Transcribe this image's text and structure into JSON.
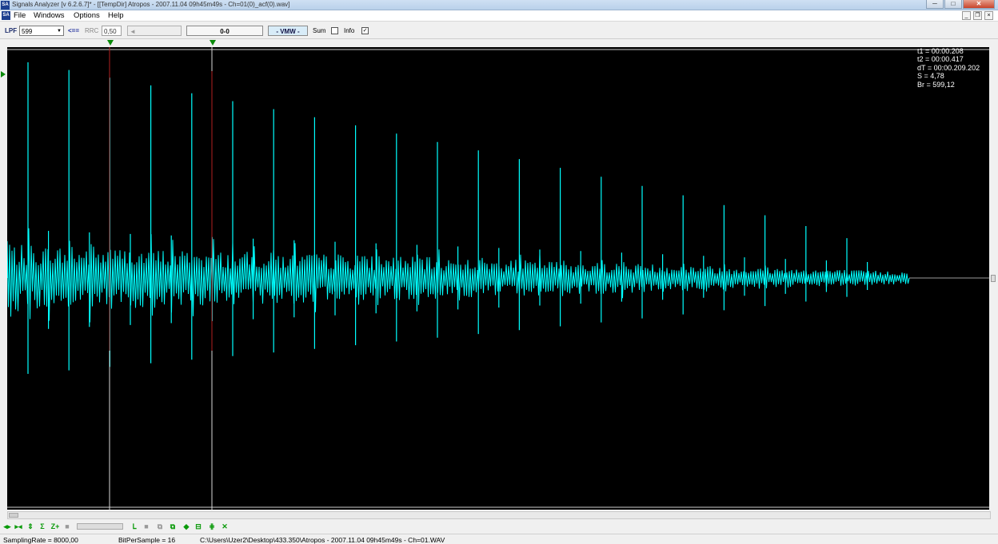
{
  "window": {
    "app_icon": "SA",
    "title": "Signals Analyzer [v 6.2.6.7]* - [[TempDir] Atropos - 2007.11.04 09h45m49s - Ch=01(0)_acf(0).wav]",
    "buttons": {
      "minimize": "─",
      "maximize": "□",
      "close": "✕"
    }
  },
  "menu": {
    "icon": "SA",
    "items": [
      "File",
      "Windows",
      "Options",
      "Help"
    ],
    "mdi": {
      "minimize": "_",
      "restore": "❐",
      "close": "×"
    }
  },
  "toolbar": {
    "lpf_label": "LPF",
    "lpf_value": "599",
    "arrow_label": "<==",
    "rrc_label": "RRC",
    "rrc_value": "0,50",
    "slider_marker": "◄",
    "range_value": "0-0",
    "vmw_label": "- VMW -",
    "sum_label": "Sum",
    "sum_checked": false,
    "info_label": "Info",
    "info_checked": true,
    "check_mark": "✓"
  },
  "readout": {
    "lines": [
      "t1 = 00:00.208",
      "t2 = 00:00.417",
      "dT = 00:00.209.202",
      "S = 4,78",
      "Br = 599,12"
    ]
  },
  "colors": {
    "scope_bg": "#000000",
    "waveform": "#00ffff",
    "marker_line": "#b22020",
    "cursor_line": "#d8d8d8",
    "marker_green": "#0a8a0a"
  },
  "bottom_icons": [
    "prev-icon",
    "fit-icon",
    "zoom-vertical-icon",
    "zoom-in-vertical-icon",
    "zoom-plus-icon",
    "stop-icon",
    "select-icon",
    "gray-box-icon",
    "copy-icon",
    "paste-icon",
    "diamond-icon",
    "minus-box-icon",
    "grid-icon",
    "close-x-icon"
  ],
  "status": {
    "sampling_rate": "SamplingRate = 8000,00",
    "bit_per_sample": "BitPerSample = 16",
    "file_path": "C:\\Users\\Uzer2\\Desktop\\433.350\\Atropos - 2007.11.04 09h45m49s - Ch=01.WAV"
  }
}
